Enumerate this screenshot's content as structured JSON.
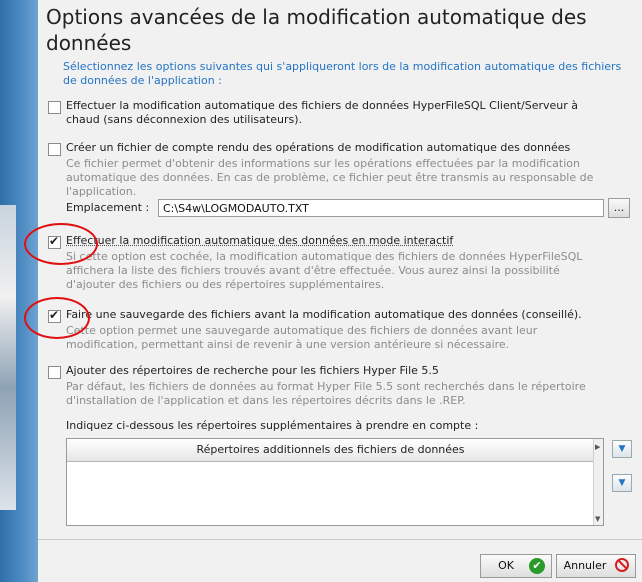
{
  "dialog": {
    "title": "Options avancées de la modification automatique des données",
    "intro": "Sélectionnez les options suivantes qui s'appliqueront lors de la modification automatique des fichiers de données de l'application :"
  },
  "options": [
    {
      "checked": false,
      "label": "Effectuer la modification automatique des fichiers de données HyperFileSQL Client/Serveur à chaud (sans déconnexion des utilisateurs).",
      "description": ""
    },
    {
      "checked": false,
      "label": "Créer un fichier de compte rendu des opérations de modification automatique des données",
      "description": "Ce fichier permet d'obtenir des informations sur les opérations effectuées par la modification automatique des données. En cas de problème, ce fichier peut être transmis au responsable de l'application."
    },
    {
      "checked": true,
      "label": "Effectuer la modification automatique des données en mode interactif",
      "description": "Si cette option est cochée, la modification automatique des fichiers de données HyperFileSQL affichera la liste des fichiers trouvés avant d'être effectuée. Vous aurez ainsi la possibilité d'ajouter des fichiers ou des répertoires supplémentaires."
    },
    {
      "checked": true,
      "label": "Faire une sauvegarde des fichiers avant la modification automatique des données (conseillé).",
      "description": "Cette option permet une sauvegarde automatique des fichiers de données avant leur modification, permettant ainsi de revenir à une version antérieure si nécessaire."
    },
    {
      "checked": false,
      "label": "Ajouter des répertoires de recherche pour les fichiers Hyper File 5.5",
      "description": "Par défaut, les fichiers de données au format Hyper File 5.5 sont recherchés dans le répertoire d'installation de l'application et dans les répertoires décrits dans le .REP."
    }
  ],
  "location": {
    "label": "Emplacement :",
    "value": "C:\\S4w\\LOGMODAUTO.TXT",
    "browse_label": "..."
  },
  "directories": {
    "prompt": "Indiquez ci-dessous les répertoires supplémentaires à prendre en compte :",
    "column_header": "Répertoires additionnels des fichiers de données"
  },
  "buttons": {
    "ok": "OK",
    "cancel": "Annuler"
  },
  "icons": {
    "ok": "check-circle-icon",
    "cancel": "no-entry-icon",
    "dropdown": "chevron-down-icon"
  },
  "colors": {
    "intro_text": "#2474c4",
    "annotation_circle": "#e01010",
    "description_text": "#8c8c8c"
  }
}
